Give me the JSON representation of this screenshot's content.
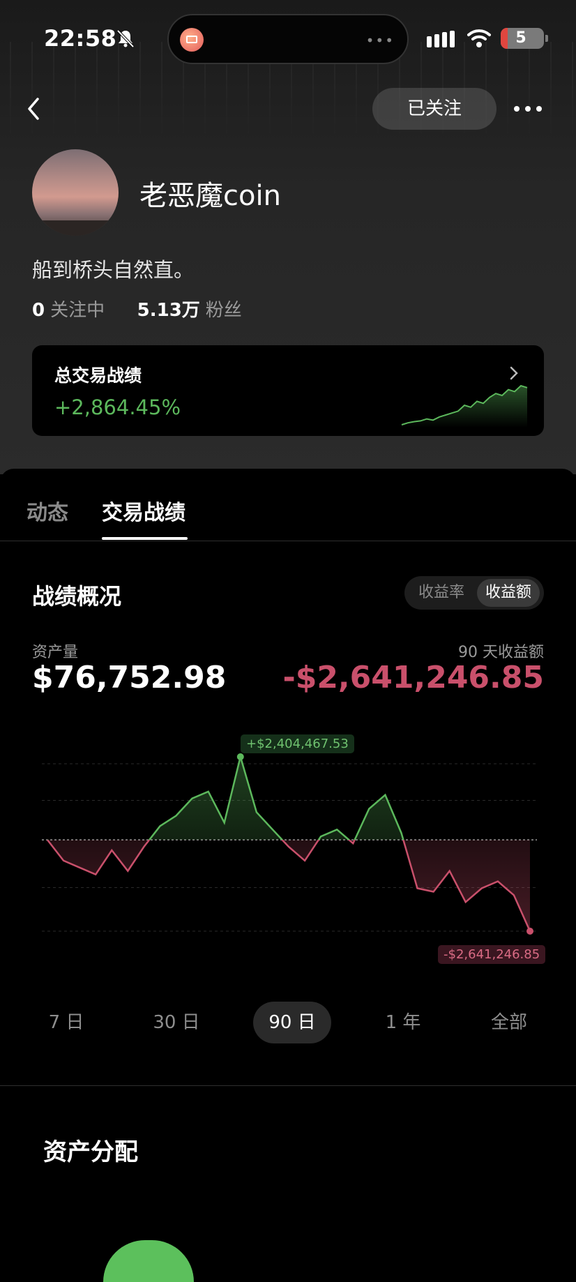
{
  "status_bar": {
    "time": "22:58",
    "battery": "5",
    "icons": [
      "bell-off-icon",
      "mail-app-icon",
      "signal-icon",
      "wifi-icon",
      "battery-icon"
    ]
  },
  "nav": {
    "follow_label": "已关注",
    "back_icon": "chevron-left-icon",
    "more_icon": "more-dots-icon"
  },
  "profile": {
    "username": "老恶魔coin",
    "bio": "船到桥头自然直。",
    "following_count": "0",
    "following_label": "关注中",
    "followers_count": "5.13万",
    "followers_label": "粉丝"
  },
  "total_card": {
    "title": "总交易战绩",
    "value": "+2,864.45%"
  },
  "tabs": [
    {
      "label": "动态",
      "active": false
    },
    {
      "label": "交易战绩",
      "active": true
    }
  ],
  "overview": {
    "title": "战绩概况",
    "toggle": [
      {
        "label": "收益率",
        "active": false
      },
      {
        "label": "收益额",
        "active": true
      }
    ],
    "asset_label": "资产量",
    "asset_value": "$76,752.98",
    "pnl_label": "90 天收益额",
    "pnl_value": "-$2,641,246.85",
    "max_tag": "+$2,404,467.53",
    "min_tag": "-$2,641,246.85"
  },
  "chart_data": {
    "type": "line",
    "title": "",
    "xlabel": "",
    "ylabel": "",
    "x": [
      0,
      3,
      6,
      9,
      12,
      15,
      18,
      21,
      24,
      27,
      30,
      33,
      36,
      39,
      42,
      45,
      48,
      51,
      54,
      57,
      60,
      63,
      66,
      69,
      72,
      75,
      78,
      81,
      84,
      87,
      90
    ],
    "values": [
      0,
      -600000,
      -800000,
      -1000000,
      -300000,
      -900000,
      -200000,
      400000,
      700000,
      1200000,
      1400000,
      500000,
      2404467.53,
      800000,
      300000,
      -200000,
      -600000,
      100000,
      300000,
      -100000,
      900000,
      1300000,
      200000,
      -1400000,
      -1500000,
      -900000,
      -1800000,
      -1400000,
      -1200000,
      -1600000,
      -2641246.85
    ],
    "color_positive": "#5cb85c",
    "color_negative": "#c9506b",
    "grid": true,
    "baseline": 0
  },
  "sparkline": [
    0,
    0.05,
    0.08,
    0.1,
    0.15,
    0.12,
    0.2,
    0.25,
    0.3,
    0.35,
    0.5,
    0.45,
    0.6,
    0.55,
    0.7,
    0.8,
    0.75,
    0.9,
    0.85,
    1.0,
    0.95
  ],
  "ranges": [
    {
      "label": "7 日",
      "active": false
    },
    {
      "label": "30 日",
      "active": false
    },
    {
      "label": "90 日",
      "active": true
    },
    {
      "label": "1 年",
      "active": false
    },
    {
      "label": "全部",
      "active": false
    }
  ],
  "allocation": {
    "title": "资产分配"
  }
}
